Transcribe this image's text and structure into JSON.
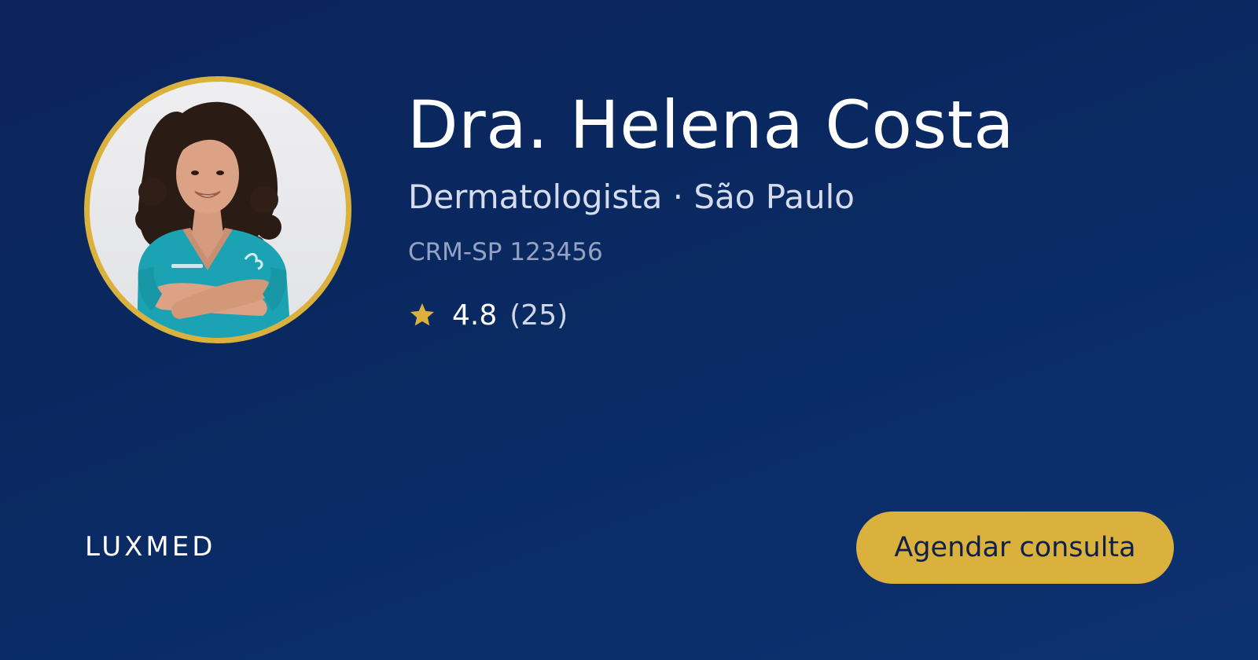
{
  "profile": {
    "name": "Dra. Helena Costa",
    "specialty_location": "Dermatologista · São Paulo",
    "registration": "CRM-SP 123456",
    "rating": {
      "icon": "star-icon",
      "score": "4.8",
      "count": "(25)"
    }
  },
  "brand": "LUXMED",
  "cta": {
    "label": "Agendar consulta"
  },
  "colors": {
    "background": "#0b2a63",
    "accent": "#d9b13c",
    "name_text": "#ffffff",
    "secondary_text": "#d6dced",
    "muted_text": "#95a3c2",
    "button_text": "#10204a"
  }
}
